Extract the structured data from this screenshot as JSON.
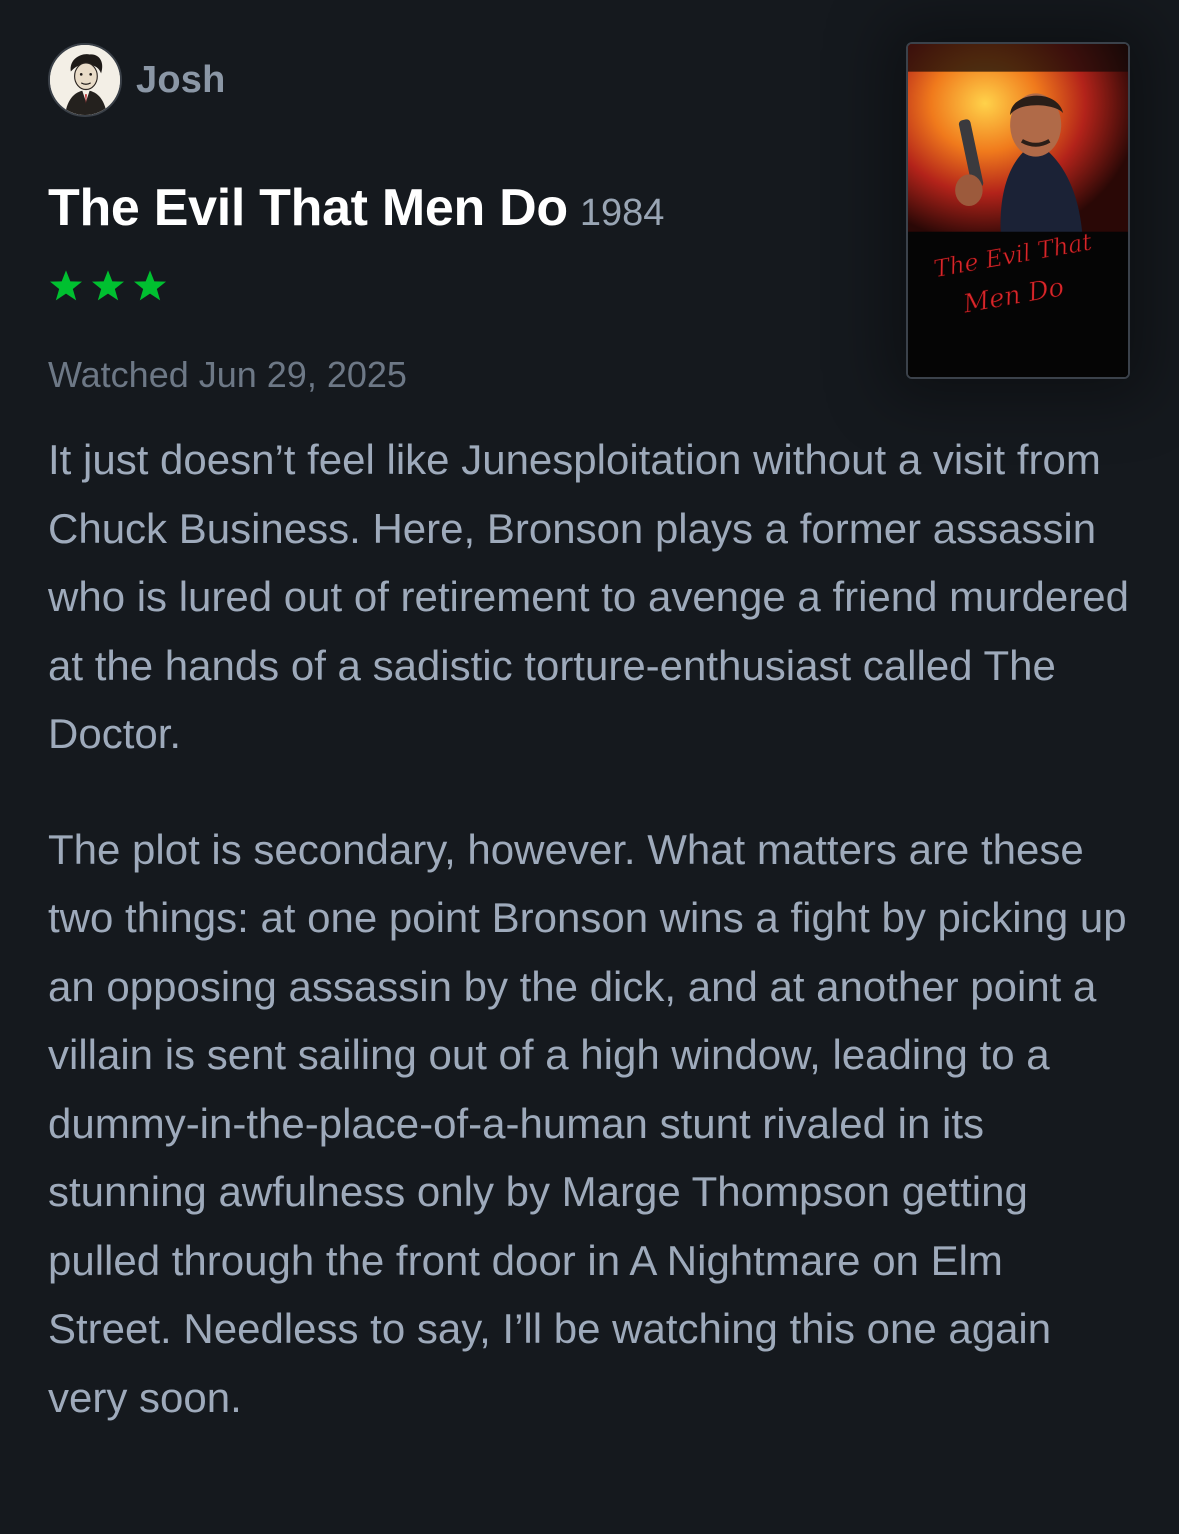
{
  "review": {
    "author": {
      "name": "Josh",
      "avatar_icon": "avatar-caricature"
    },
    "film": {
      "title": "The Evil That Men Do",
      "year": "1984",
      "poster_text": "The Evil That Men Do"
    },
    "rating": {
      "stars": 3,
      "max_stars": 5,
      "star_color": "#00c030"
    },
    "watched_label": "Watched Jun 29, 2025",
    "paragraphs": [
      "It just doesn’t feel like Junesploitation without a visit from Chuck Business. Here, Bronson plays a former assassin who is lured out of retirement to avenge a friend murdered at the hands of a sadistic torture-enthusiast called The Doctor.",
      "The plot is secondary, however. What matters are these two things: at one point Bronson wins a fight by picking up an opposing assassin by the dick, and at another point a villain is sent sailing out of a high window, leading to a dummy-in-the-place-of-a-human stunt rivaled in its stunning awfulness only by Marge Thompson getting pulled through the front door in A Nightmare on Elm Street. Needless to say, I’ll be watching this one again very soon."
    ]
  },
  "colors": {
    "background": "#15191e",
    "title": "#ffffff",
    "body_text": "#9eaabb",
    "muted_text": "#6d7886",
    "accent_green": "#00c030"
  }
}
